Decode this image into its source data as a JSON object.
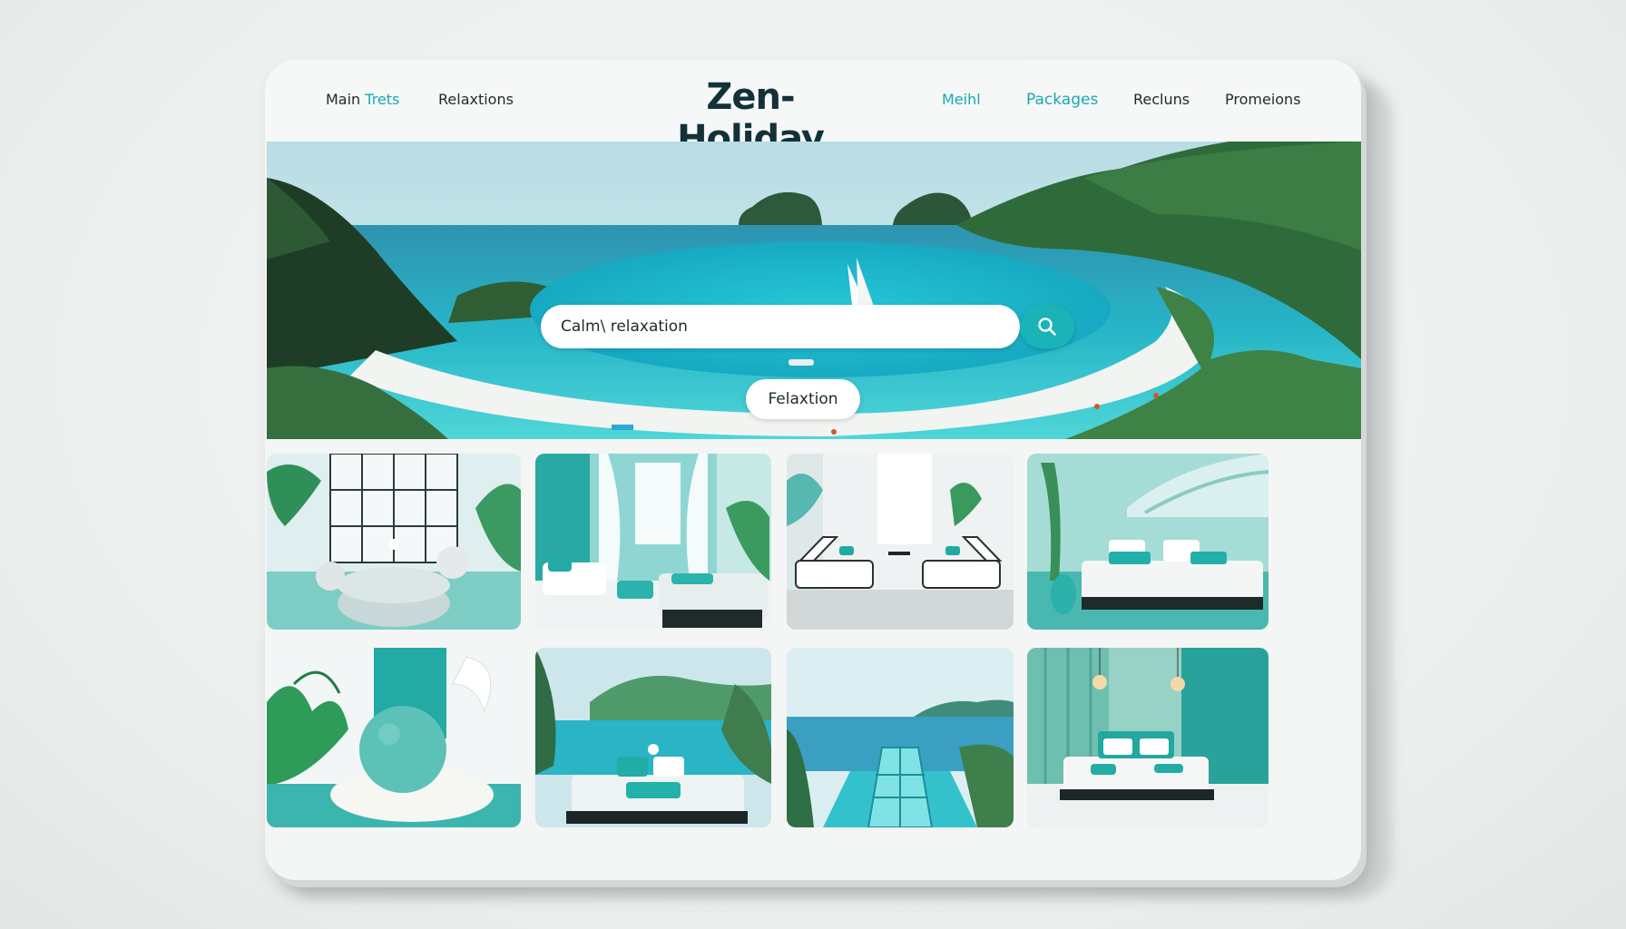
{
  "header": {
    "brand": "Zen-Holiday",
    "nav_left": [
      {
        "label_part1": "Main ",
        "label_part2": "Trets"
      },
      {
        "label": "Relaxtions"
      }
    ],
    "nav_right": [
      {
        "label": "Meihl"
      },
      {
        "label": "Packages"
      },
      {
        "label": "Recluns"
      },
      {
        "label": "Promeions"
      }
    ]
  },
  "hero": {
    "search_value": "Calm\\ relaxation",
    "search_icon": "search-icon",
    "tag_label": "Felaxtion"
  },
  "gallery": {
    "tiles": [
      {
        "name": "tile-zen-lounge"
      },
      {
        "name": "tile-curtain-lounge"
      },
      {
        "name": "tile-white-loungers"
      },
      {
        "name": "tile-teal-bedroom"
      },
      {
        "name": "tile-stone-sphere"
      },
      {
        "name": "tile-sea-view-bed"
      },
      {
        "name": "tile-infinity-pool"
      },
      {
        "name": "tile-pendant-bedroom"
      }
    ]
  },
  "colors": {
    "accent": "#18a9b3",
    "brand_text": "#14313a",
    "search_button": "#19b3b8",
    "teal_dark": "#1a9a98"
  }
}
